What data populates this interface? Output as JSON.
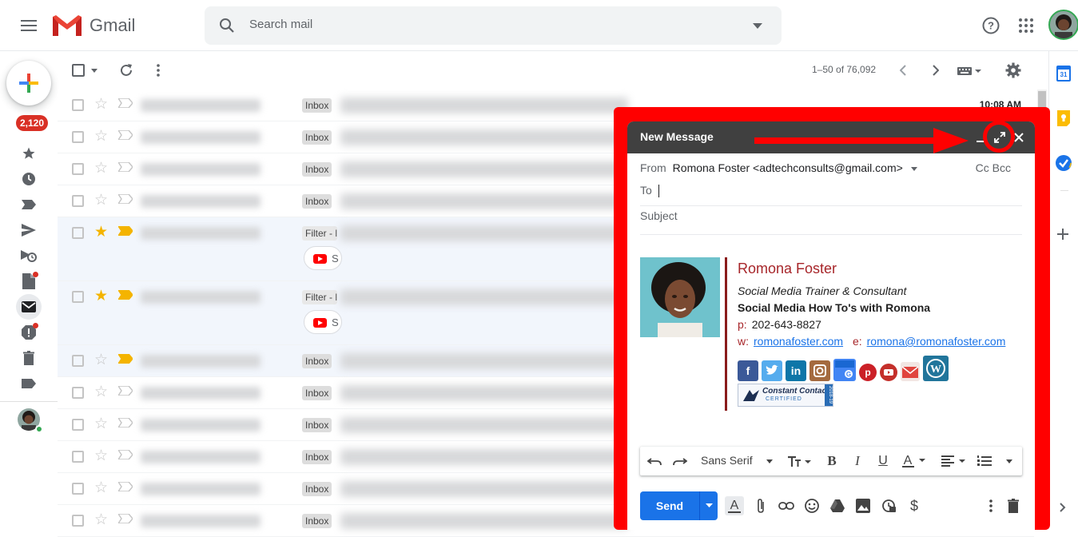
{
  "header": {
    "app_name": "Gmail",
    "search_placeholder": "Search mail"
  },
  "rail": {
    "unread_count": "2,120"
  },
  "toolbar": {
    "pagination": "1–50 of 76,092"
  },
  "mail_rows": [
    {
      "label": "Inbox",
      "starred": false,
      "time": "10:08 AM"
    },
    {
      "label": "Inbox",
      "starred": false
    },
    {
      "label": "Inbox",
      "starred": false
    },
    {
      "label": "Inbox",
      "starred": false
    },
    {
      "label": "Filter - l",
      "starred": true,
      "chip_letter": "S"
    },
    {
      "label": "Filter - l",
      "starred": true,
      "chip_letter": "S"
    },
    {
      "label": "Inbox",
      "starred": false
    },
    {
      "label": "Inbox",
      "starred": false
    },
    {
      "label": "Inbox",
      "starred": false
    },
    {
      "label": "Inbox",
      "starred": false
    },
    {
      "label": "Inbox",
      "starred": false
    },
    {
      "label": "Inbox",
      "starred": false
    }
  ],
  "compose": {
    "title": "New Message",
    "from_label": "From",
    "from_value": "Romona Foster <adtechconsults@gmail.com>",
    "cc_bcc": "Cc Bcc",
    "to_label": "To",
    "subject_placeholder": "Subject",
    "font_name": "Sans Serif",
    "send_label": "Send"
  },
  "signature": {
    "name": "Romona Foster",
    "role": "Social Media Trainer & Consultant",
    "show": "Social Media How To's with Romona",
    "phone_key": "p:",
    "phone": "202-643-8827",
    "web_key": "w:",
    "website": "romonafoster.com",
    "email_key": "e:",
    "email": "romona@romonafoster.com",
    "badge_title": "Constant Contact",
    "badge_sub": "CERTIFIED",
    "badge_year": "2018-19",
    "social_icons": [
      "facebook-icon",
      "twitter-icon",
      "linkedin-icon",
      "instagram-icon",
      "google-business-icon",
      "pinterest-icon",
      "youtube-icon",
      "email-icon",
      "wordpress-icon"
    ]
  },
  "colors": {
    "annotation": "#ff0000",
    "send": "#1a73e8",
    "signature_accent": "#a7262a",
    "badge_red": "#d93025"
  }
}
